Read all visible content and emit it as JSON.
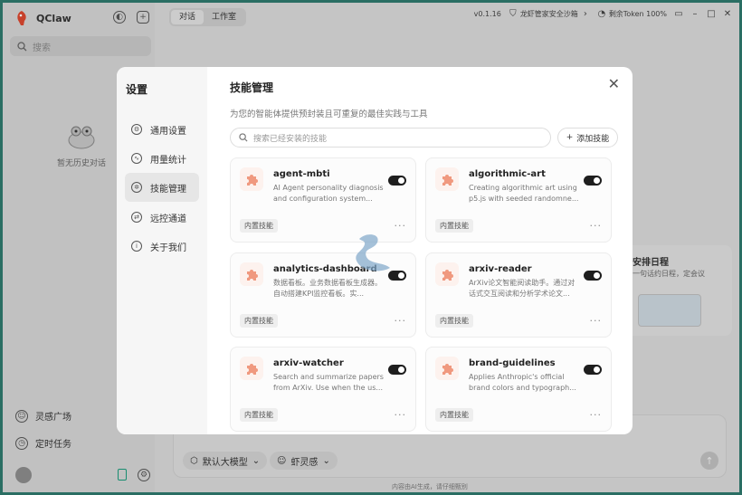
{
  "app": {
    "name": "QClaw"
  },
  "sidebar": {
    "search_placeholder": "搜索",
    "empty_history": "暂无历史对话",
    "bottom_items": [
      {
        "label": "灵感广场"
      },
      {
        "label": "定时任务"
      }
    ]
  },
  "topbar": {
    "tabs": [
      {
        "label": "对话"
      },
      {
        "label": "工作室"
      }
    ],
    "version": "v0.1.16",
    "sandbox": "龙虾管家安全沙箱",
    "token": "剩余Token 100%"
  },
  "right_card": {
    "title": "安排日程",
    "subtitle": "一句话约日程，定会议"
  },
  "composer": {
    "model_chip": "默认大模型",
    "inspire_chip": "虾灵感",
    "footnote": "内容由AI生成，请仔细甄别"
  },
  "modal": {
    "title": "设置",
    "nav": [
      {
        "label": "通用设置",
        "icon": "gear-icon"
      },
      {
        "label": "用量统计",
        "icon": "chart-icon"
      },
      {
        "label": "技能管理",
        "icon": "skill-icon"
      },
      {
        "label": "远控通道",
        "icon": "remote-icon"
      },
      {
        "label": "关于我们",
        "icon": "info-icon"
      }
    ],
    "active_nav": "技能管理",
    "heading": "技能管理",
    "subheading": "为您的智能体提供预封装且可重复的最佳实践与工具",
    "search_placeholder": "搜索已经安装的技能",
    "add_button": "添加技能",
    "skills": [
      {
        "name": "agent-mbti",
        "desc": "AI Agent personality diagnosis and configuration system...",
        "badge": "内置技能",
        "enabled": true
      },
      {
        "name": "algorithmic-art",
        "desc": "Creating algorithmic art using p5.js with seeded randomne...",
        "badge": "内置技能",
        "enabled": true
      },
      {
        "name": "analytics-dashboard",
        "desc": "数据看板。业务数据看板生成器。自动搭建KPI监控看板。实...",
        "badge": "内置技能",
        "enabled": true
      },
      {
        "name": "arxiv-reader",
        "desc": "ArXiv论文智能阅读助手。通过对话式交互阅读和分析学术论文...",
        "badge": "内置技能",
        "enabled": true
      },
      {
        "name": "arxiv-watcher",
        "desc": "Search and summarize papers from ArXiv. Use when the us...",
        "badge": "内置技能",
        "enabled": true
      },
      {
        "name": "brand-guidelines",
        "desc": "Applies Anthropic's official brand colors and typograph...",
        "badge": "内置技能",
        "enabled": true
      }
    ]
  },
  "colors": {
    "accent": "#e8735a",
    "toggle_on": "#1e1e1e",
    "frame": "#2a6e63"
  }
}
